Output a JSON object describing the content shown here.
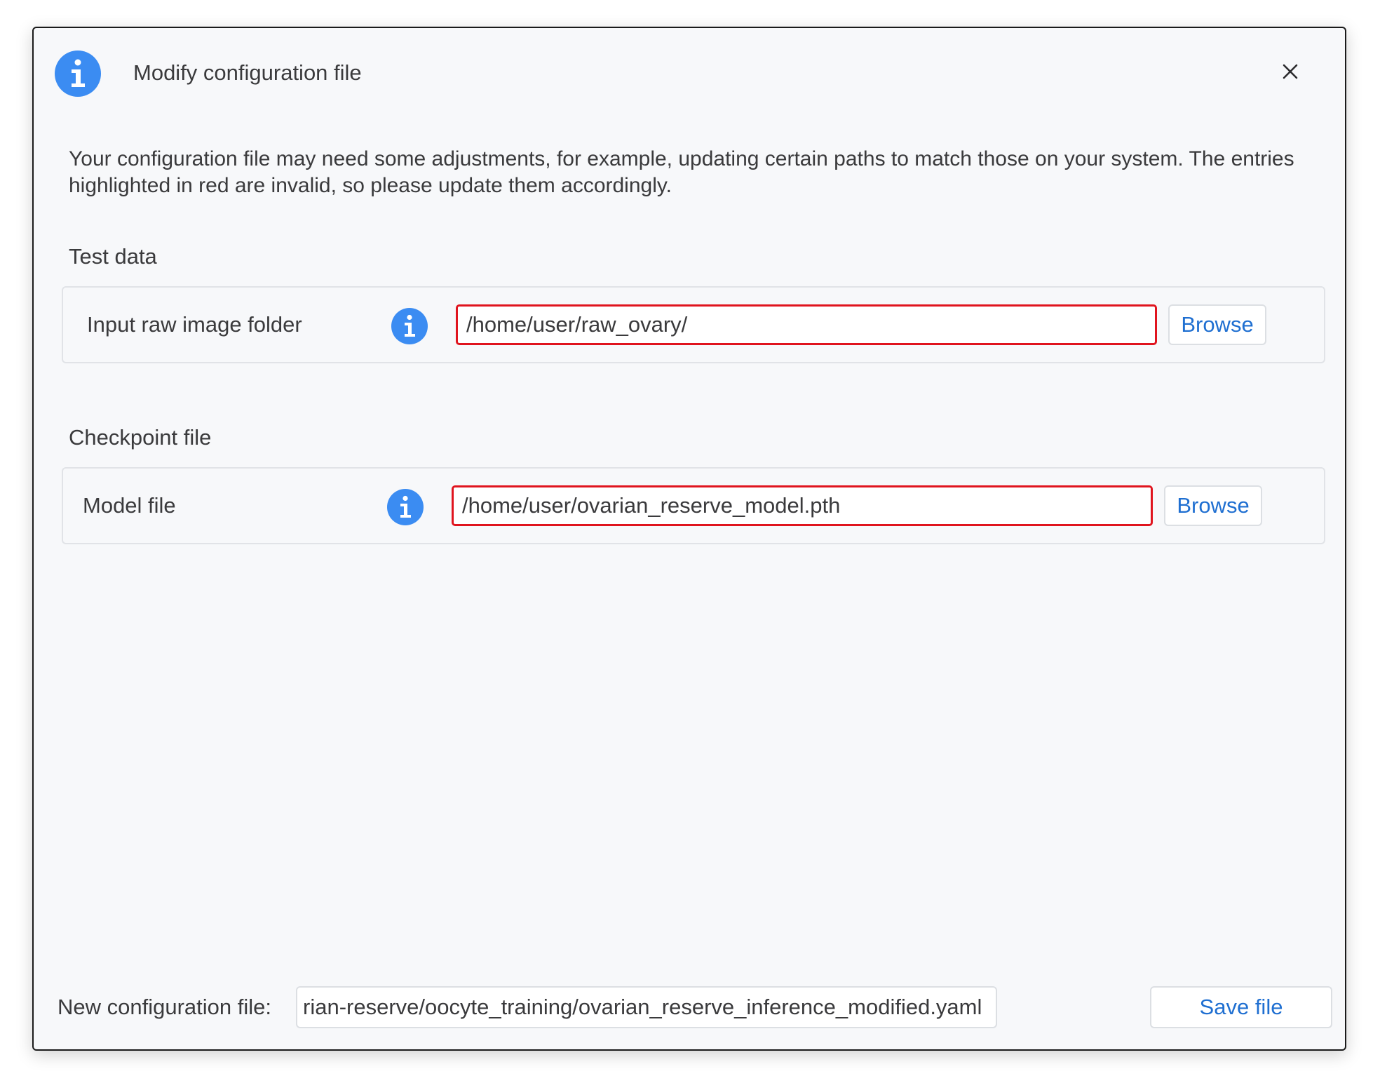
{
  "dialog": {
    "title": "Modify configuration file",
    "header_icon": "info-icon",
    "close_icon": "close-icon",
    "description": "Your configuration file may need some adjustments, for example, updating certain paths to match those on your system. The entries highlighted in red are invalid, so please update them accordingly."
  },
  "sections": {
    "test_data": {
      "title": "Test data",
      "label": "Input raw image folder",
      "value": "/home/user/raw_ovary/",
      "button": "Browse"
    },
    "checkpoint": {
      "title": "Checkpoint file",
      "label": "Model file",
      "value": "/home/user/ovarian_reserve_model.pth",
      "button": "Browse"
    }
  },
  "footer": {
    "label": "New configuration file:",
    "value": "rian-reserve/oocyte_training/ovarian_reserve_inference_modified.yaml",
    "save_label": "Save file"
  },
  "colors": {
    "accent": "#3b8cf2",
    "invalid_border": "#e0141e",
    "link_blue": "#1f6fd1"
  }
}
